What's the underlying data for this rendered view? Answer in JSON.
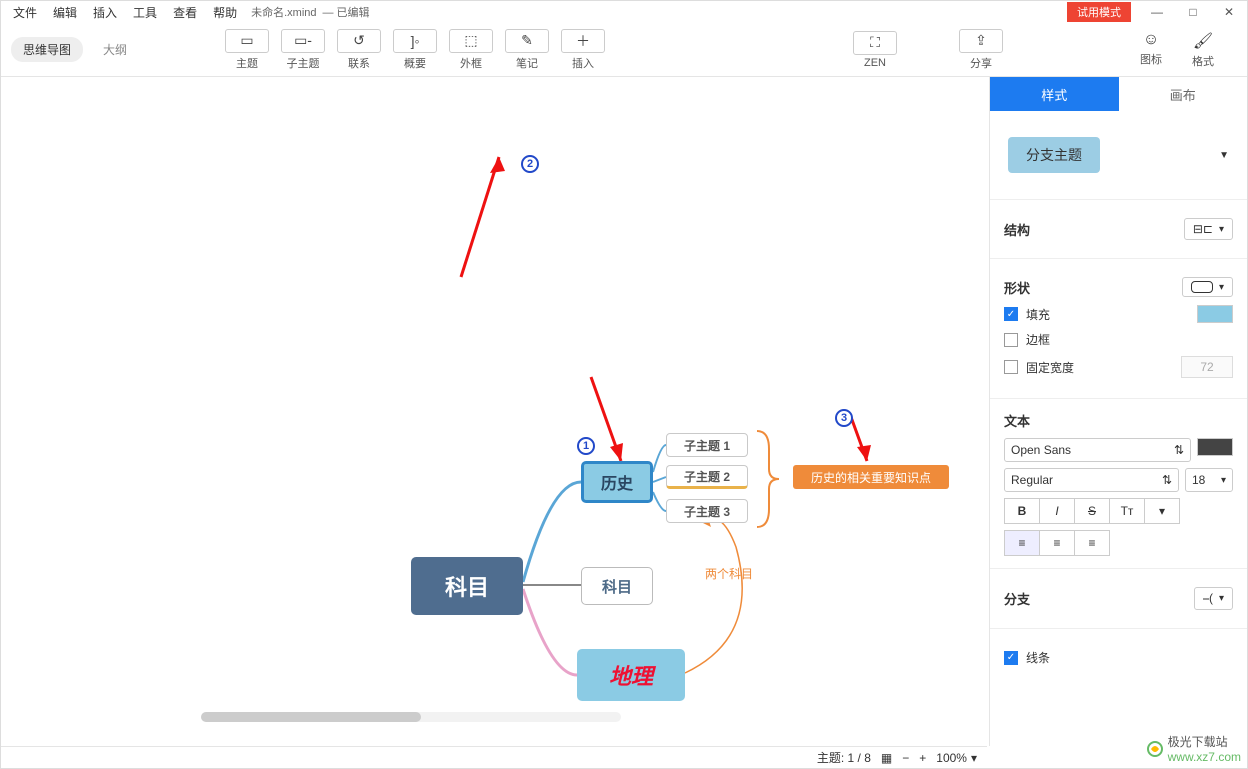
{
  "menu": {
    "file": "文件",
    "edit": "编辑",
    "insert": "插入",
    "tools": "工具",
    "view": "查看",
    "help": "帮助"
  },
  "file": {
    "name": "未命名.xmind",
    "status": "— 已编辑"
  },
  "title": {
    "trial": "试用模式"
  },
  "view_tabs": {
    "mindmap": "思维导图",
    "outline": "大纲"
  },
  "tools": {
    "topic": "主题",
    "subtopic": "子主题",
    "relation": "联系",
    "summary": "概要",
    "boundary": "外框",
    "note": "笔记",
    "insert": "插入",
    "zen": "ZEN",
    "share": "分享"
  },
  "right_tools": {
    "icons": "图标",
    "format": "格式"
  },
  "side_tabs": {
    "style": "样式",
    "canvas": "画布"
  },
  "topic_type": "分支主题",
  "sections": {
    "structure": "结构",
    "shape": "形状",
    "fill": "填充",
    "border": "边框",
    "fixed_width": "固定宽度",
    "fixed_width_val": "72",
    "text": "文本",
    "branch": "分支",
    "line": "线条"
  },
  "font": {
    "family": "Open Sans",
    "weight": "Regular",
    "size": "18"
  },
  "text_style": {
    "bold": "B",
    "italic": "I",
    "strike": "S",
    "case": "Tᴛ"
  },
  "nodes": {
    "root": "科目",
    "history": "历史",
    "subject2": "科目",
    "geo": "地理",
    "sub1": "子主题 1",
    "sub2": "子主题 2",
    "sub3": "子主题 3",
    "summary": "历史的相关重要知识点",
    "two_label": "两个科目"
  },
  "markers": {
    "m1": "1",
    "m2": "2",
    "m3": "3"
  },
  "status": {
    "topic": "主题: 1 / 8",
    "zoom": "100%"
  },
  "watermark": {
    "brand": "极光下载站",
    "url": "www.xz7.com"
  }
}
